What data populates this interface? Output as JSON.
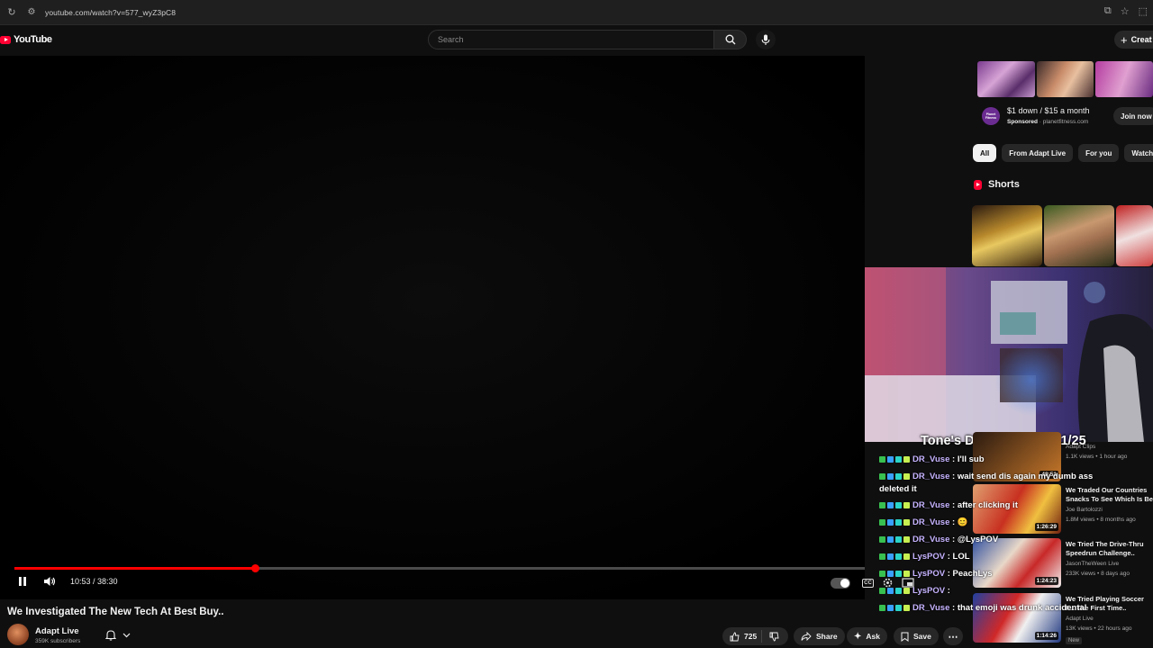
{
  "browser": {
    "url": "youtube.com/watch?v=577_wyZ3pC8"
  },
  "header": {
    "logo_text": "YouTube",
    "search_placeholder": "Search",
    "create_label": "Creat"
  },
  "player": {
    "time_current": "10:53",
    "time_total": "38:30",
    "time_display": "10:53 / 38:30",
    "progress_fraction": 0.283,
    "accent_color": "#ff0000"
  },
  "video": {
    "title": "We Investigated The New Tech At Best Buy..",
    "channel": "Adapt Live",
    "subscribers": "359K subscribers",
    "likes": "725",
    "share_label": "Share",
    "ask_label": "Ask",
    "save_label": "Save"
  },
  "ad": {
    "title": "$1 down / $15 a month",
    "sponsored": "Sponsored",
    "domain": "planetfitness.com",
    "join_label": "Join now",
    "logo_text": "Planet Fitness"
  },
  "chips": [
    "All",
    "From Adapt Live",
    "For you",
    "Watched"
  ],
  "shorts": {
    "label": "Shorts"
  },
  "stream_overlay": {
    "title": "Tone's Daily Sub Goal 1/25"
  },
  "chat": [
    {
      "user": "DR_Vuse",
      "message": "I'll sub"
    },
    {
      "user": "DR_Vuse",
      "message": "wait send dis again my dumb ass deleted it"
    },
    {
      "user": "DR_Vuse",
      "message": "after clicking it"
    },
    {
      "user": "DR_Vuse",
      "message": "😊"
    },
    {
      "user": "DR_Vuse",
      "message": "@LysPOV"
    },
    {
      "user": "LysPOV",
      "message": "LOL"
    },
    {
      "user": "LysPOV",
      "message": "PeachLys"
    },
    {
      "user": "LysPOV",
      "message": ""
    },
    {
      "user": "DR_Vuse",
      "message": "that emoji was drunk accidental"
    }
  ],
  "recommendations": [
    {
      "title": "",
      "channel": "Adapt Clips",
      "meta": "1.1K views • 1 hour ago",
      "duration": "48:51"
    },
    {
      "title": "We Traded Our Countries Snacks To See Which Is Be",
      "channel": "Joe Bartolozzi",
      "meta": "1.8M views • 8 months ago",
      "duration": "1:26:29"
    },
    {
      "title": "We Tried The Drive-Thru Speedrun Challenge..",
      "channel": "JasonTheWeen Live",
      "meta": "233K views • 8 days ago",
      "duration": "1:24:23"
    },
    {
      "title": "We Tried Playing Soccer F... The First Time..",
      "channel": "Adapt Live",
      "meta": "13K views • 22 hours ago",
      "duration": "1:14:26",
      "badge": "New"
    }
  ]
}
